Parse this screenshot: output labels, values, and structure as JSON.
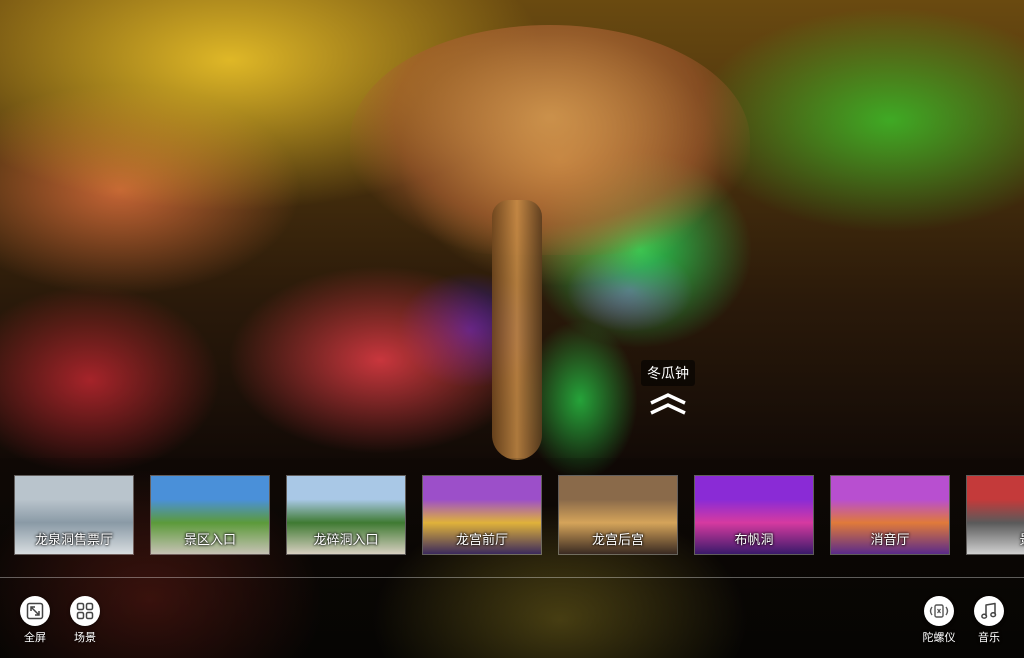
{
  "hotspot": {
    "label": "冬瓜钟",
    "icon": "double-chevron-up-icon"
  },
  "scenes": [
    {
      "label": "龙泉洞售票厅",
      "colors": [
        "#b9c4cc",
        "#8a9aa6",
        "#d8dde0"
      ]
    },
    {
      "label": "景区入口",
      "colors": [
        "#4a90d9",
        "#5c9a3a",
        "#c7c2b5"
      ]
    },
    {
      "label": "龙碎洞入口",
      "colors": [
        "#a9c8e6",
        "#3f7a32",
        "#d7cfc0"
      ]
    },
    {
      "label": "龙宫前厅",
      "colors": [
        "#9c4fc9",
        "#e0b23a",
        "#3b2a5c"
      ]
    },
    {
      "label": "龙宫后宫",
      "colors": [
        "#8a6a4a",
        "#d5a45a",
        "#3a2a22"
      ]
    },
    {
      "label": "布帆洞",
      "colors": [
        "#8a2bd6",
        "#d63aa0",
        "#3a1a6a"
      ]
    },
    {
      "label": "消音厅",
      "colors": [
        "#b84fd0",
        "#e07a3a",
        "#5a2a8a"
      ]
    },
    {
      "label": "景",
      "colors": [
        "#c43a3a",
        "#5a5a5a",
        "#d0d0d0"
      ]
    }
  ],
  "controls": {
    "fullscreen": {
      "label": "全屏",
      "icon": "fullscreen-icon"
    },
    "scenes": {
      "label": "场景",
      "icon": "grid-icon"
    },
    "gyroscope": {
      "label": "陀螺仪",
      "icon": "gyroscope-icon"
    },
    "music": {
      "label": "音乐",
      "icon": "music-note-icon"
    }
  }
}
